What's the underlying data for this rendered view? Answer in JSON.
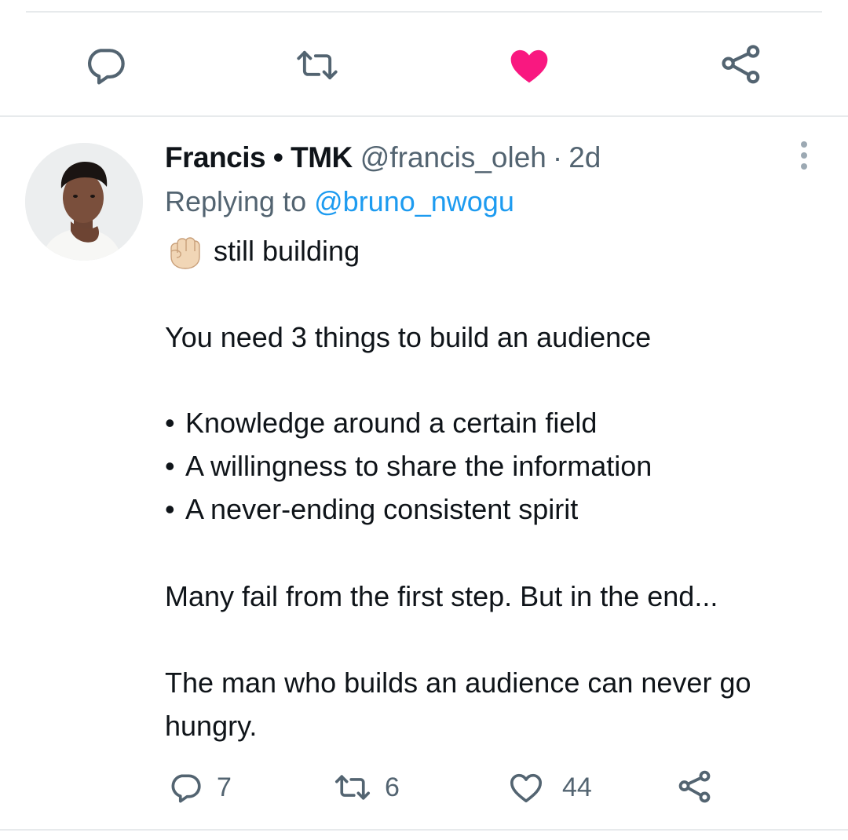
{
  "top_action_bar": {
    "icons": [
      "reply-icon",
      "retweet-icon",
      "like-filled-icon",
      "share-icon"
    ],
    "like_color": "#f91880"
  },
  "tweet": {
    "author": {
      "display_name": "Francis • TMK",
      "handle": "@francis_oleh",
      "separator": "·",
      "age": "2d"
    },
    "replying_prefix": "Replying to",
    "replying_to": "@bruno_nwogu",
    "emoji": "raised-fist-light-skin-tone",
    "lines": {
      "first": "still building",
      "intro": "You need 3 things to build an audience",
      "bullet_1": "Knowledge around a certain field",
      "bullet_2": "A willingness to share the information",
      "bullet_3": "A never-ending consistent spirit",
      "fail": "Many fail from the first step. But in the end...",
      "closing_1": "The man who builds an audience can never go",
      "closing_2": "hungry."
    },
    "bullet_char": "•",
    "metrics": {
      "replies": "7",
      "retweets": "6",
      "likes": "44"
    }
  },
  "colors": {
    "text_primary": "#0f1419",
    "text_secondary": "#536471",
    "link": "#1d9bf0",
    "like": "#f91880",
    "divider": "#e7eaec"
  }
}
